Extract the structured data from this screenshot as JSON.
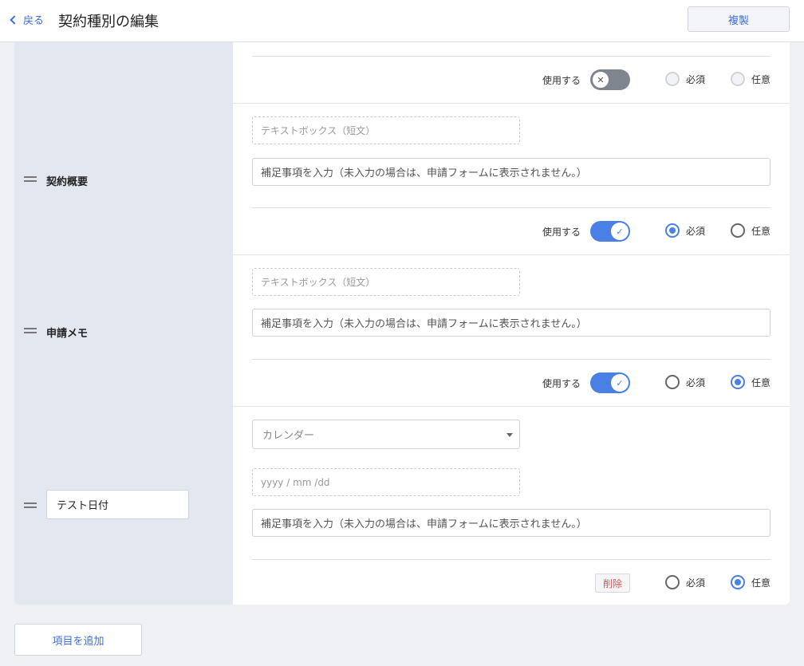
{
  "header": {
    "back_label": "戻る",
    "title": "契約種別の編集",
    "copy_label": "複製"
  },
  "controls": {
    "use_label": "使用する",
    "required_label": "必須",
    "optional_label": "任意",
    "delete_label": "削除"
  },
  "rows": [
    {
      "label": "",
      "use_enabled": false,
      "required_selection": "none",
      "radios_disabled": true
    },
    {
      "label": "契約概要",
      "field_type": "テキストボックス（短文）",
      "note_placeholder": "補足事項を入力（未入力の場合は、申請フォームに表示されません。）",
      "use_enabled": true,
      "required_selection": "required"
    },
    {
      "label": "申請メモ",
      "field_type": "テキストボックス（短文）",
      "note_placeholder": "補足事項を入力（未入力の場合は、申請フォームに表示されません。）",
      "use_enabled": true,
      "required_selection": "optional"
    },
    {
      "name_value": "テスト日付",
      "type_select": "カレンダー",
      "date_placeholder": "yyyy / mm /dd",
      "note_placeholder": "補足事項を入力（未入力の場合は、申請フォームに表示されません。）",
      "required_selection": "optional"
    }
  ],
  "footer": {
    "add_label": "項目を追加"
  },
  "colors": {
    "accent": "#4a7fe6",
    "link": "#3d6fe0",
    "danger": "#d9534f",
    "label_column_bg": "#e3e7ef",
    "page_bg": "#eff0f4"
  }
}
